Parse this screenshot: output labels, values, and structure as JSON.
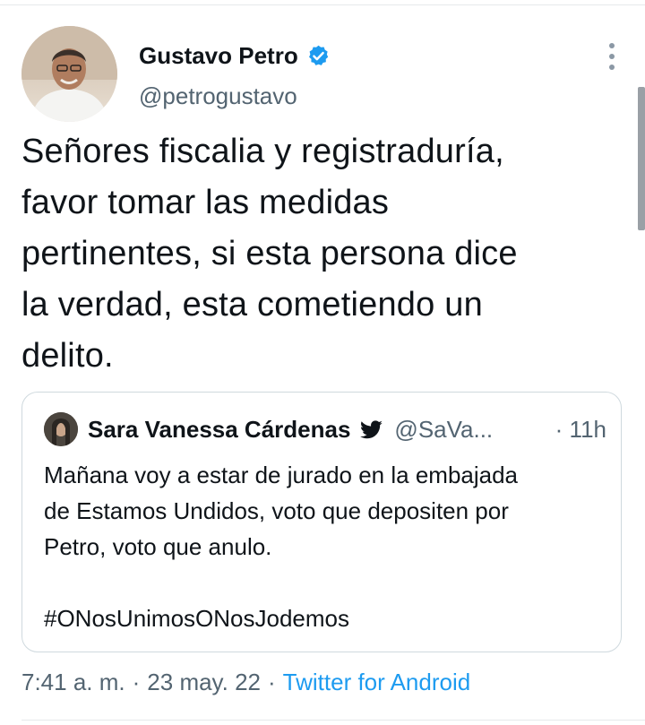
{
  "tweet": {
    "author_name": "Gustavo Petro",
    "author_handle": "@petrogustavo",
    "text": "Señores fiscalia y registraduría,\nfavor tomar las medidas\npertinentes, si esta persona dice\nla verdad, esta cometiendo un\ndelito.",
    "time": "7:41 a. m.",
    "separator": "·",
    "date": "23 may. 22",
    "source": "Twitter for Android"
  },
  "quoted_tweet": {
    "author_name": "Sara Vanessa Cárdenas",
    "author_handle": "@SaVa...",
    "time": "· 11h",
    "text": "Mañana voy a estar de jurado en la embajada\nde Estamos Undidos, voto que depositen por\nPetro, voto que anulo.\n\n#ONosUnimosONosJodemos"
  },
  "icons": {
    "verified": "verified-badge-icon",
    "more": "more-vertical-icon",
    "bird": "twitter-bird-icon"
  },
  "colors": {
    "link": "#1d9bf0",
    "secondary_text": "#536471",
    "primary_text": "#0f1419",
    "border": "#cfd9de"
  }
}
